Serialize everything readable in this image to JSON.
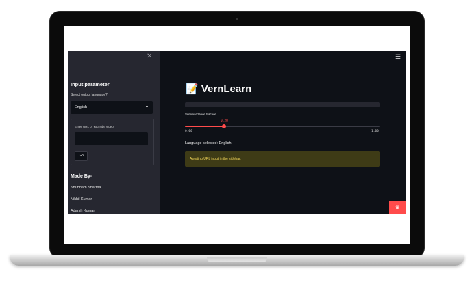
{
  "sidebar": {
    "close_icon": "close-icon",
    "title": "Input parameter",
    "language_label": "Select output language?",
    "language_value": "English",
    "url_label": "Enter URL of YouTube video:",
    "url_value": "",
    "go_label": "Go",
    "made_by_title": "Made By-",
    "authors": [
      "Shubham Sharma",
      "Nikhil Kumar",
      "Adarsh Kumar"
    ]
  },
  "header": {
    "menu_icon": "hamburger-menu-icon"
  },
  "main": {
    "title_icon": "memo-icon",
    "title": "VernLearn",
    "progress_fraction": 0.0,
    "slider": {
      "label": "Summarization fraction",
      "value": "0.20",
      "value_num": 0.2,
      "min": "0.00",
      "max": "1.00",
      "min_num": 0,
      "max_num": 1
    },
    "language_selected": "Language selected: English",
    "alert": "Awaiting URL input in the sidebar."
  },
  "badge_icon": "crown-icon",
  "colors": {
    "accent": "#ff4b4b",
    "background": "#0e1117",
    "sidebar": "#262730",
    "warning_bg": "#3e3b16",
    "warning_text": "#f5d85a"
  }
}
